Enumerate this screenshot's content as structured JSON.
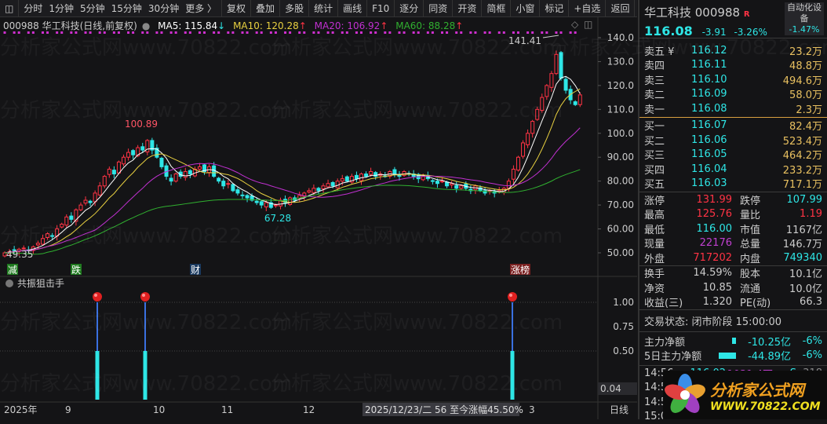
{
  "toolbar": {
    "periods": [
      "分时",
      "1分钟",
      "5分钟",
      "15分钟",
      "30分钟",
      "更多 〉"
    ],
    "buttons": [
      "复权",
      "叠加",
      "多股",
      "统计",
      "画线",
      "F10",
      "逐分",
      "同资",
      "开资",
      "简框",
      "小窗",
      "标记",
      "+自选",
      "返回"
    ]
  },
  "info": {
    "title": "000988 华工科技(日线,前复权)",
    "ma5": "MA5: 115.84",
    "ma10": "MA10: 120.28",
    "ma20": "MA20: 106.92",
    "ma60": "MA60: 88.28",
    "ma5_arrow": "↓",
    "ma10_arrow": "↑",
    "ma20_arrow": "↑",
    "ma60_arrow": "↑"
  },
  "colors": {
    "up": "#ff3344",
    "down": "#2ee6e6",
    "ma5": "#ffffff",
    "ma10": "#e8d040",
    "ma20": "#c030d0",
    "ma60": "#30b030"
  },
  "chart_data": {
    "type": "candlestick",
    "closes": [
      50,
      50.5,
      51,
      51.5,
      52,
      51,
      52.5,
      54,
      56,
      58,
      57,
      60,
      62,
      65,
      64,
      68,
      70,
      72,
      71,
      75,
      78,
      82,
      85,
      83,
      88,
      90,
      92,
      91,
      94,
      93,
      97,
      93,
      90,
      86,
      82,
      80,
      83,
      82,
      84,
      83,
      85,
      86,
      84,
      86,
      82,
      80,
      78,
      79,
      76,
      75,
      74,
      73,
      72,
      71,
      70,
      71,
      69,
      70,
      72,
      71,
      73,
      72,
      74,
      75,
      76,
      77,
      76,
      78,
      79,
      78,
      80,
      81,
      80,
      82,
      81,
      83,
      82,
      84,
      82,
      83,
      82,
      84,
      83,
      82,
      84,
      83,
      82,
      81,
      82,
      81,
      80,
      79,
      80,
      78,
      79,
      77,
      78,
      77,
      76,
      78,
      76,
      75,
      76,
      75,
      76,
      77,
      80,
      85,
      90,
      96,
      100,
      105,
      110,
      115,
      120,
      125,
      133,
      123,
      118,
      114,
      112,
      116.08
    ],
    "ylim": [
      45,
      145
    ],
    "yticks": [
      "140.0",
      "130.0",
      "120.0",
      "110.0",
      "100.0",
      "90.00",
      "80.00",
      "70.00",
      "60.00",
      "50.00"
    ],
    "ytick_values": [
      140,
      130,
      120,
      110,
      100,
      90,
      80,
      70,
      60,
      50
    ],
    "annotations": {
      "high": "141.41",
      "mid_high": "100.89",
      "low": "67.28",
      "start": "49.35"
    },
    "events": [
      "减",
      "跌",
      "财",
      "涨榜"
    ],
    "xticks": [
      "2025年",
      "9",
      "10",
      "11",
      "12",
      "3"
    ],
    "xtick_status": "2025/12/23/二 56 至今涨幅45.50%",
    "period": "日线"
  },
  "indicator": {
    "name": "共振狙击手",
    "yticks": [
      "1.00",
      "0.75",
      "0.50"
    ],
    "current": "0.04",
    "signals": [
      1,
      1,
      1
    ]
  },
  "quote": {
    "name": "华工科技 000988",
    "r": "R",
    "price": "116.08",
    "chg": "-3.91",
    "pct": "-3.26%",
    "sector": "自动化设备",
    "sector_pct": "-1.47%",
    "asks": [
      [
        "卖五 ¥",
        "116.12",
        "23.2万"
      ],
      [
        "卖四",
        "116.11",
        "48.8万"
      ],
      [
        "卖三",
        "116.10",
        "494.6万"
      ],
      [
        "卖二",
        "116.09",
        "58.0万"
      ],
      [
        "卖一",
        "116.08",
        "2.3万"
      ]
    ],
    "bids": [
      [
        "买一",
        "116.07",
        "82.4万"
      ],
      [
        "买二",
        "116.06",
        "523.4万"
      ],
      [
        "买三",
        "116.05",
        "464.2万"
      ],
      [
        "买四",
        "116.04",
        "233.2万"
      ],
      [
        "买五",
        "116.03",
        "717.1万"
      ]
    ],
    "stats": [
      [
        "涨停",
        "131.99",
        "跌停",
        "107.99"
      ],
      [
        "最高",
        "125.76",
        "量比",
        "1.19"
      ],
      [
        "最低",
        "116.00",
        "市值",
        "1167亿"
      ],
      [
        "现量",
        "22176",
        "总量",
        "146.7万"
      ],
      [
        "外盘",
        "717202",
        "内盘",
        "749340"
      ]
    ],
    "stats2": [
      [
        "换手",
        "14.59%",
        "股本",
        "10.1亿"
      ],
      [
        "净资",
        "10.85",
        "流通",
        "10.0亿"
      ],
      [
        "收益(三)",
        "1.320",
        "PE(动)",
        "66.3"
      ]
    ],
    "status": "交易状态: 闭市阶段 15:00:00",
    "flow": [
      [
        "主力净额",
        "-10.25亿",
        "-6%"
      ],
      [
        "5日主力净额",
        "-44.89亿",
        "-6%"
      ]
    ],
    "ticks": [
      [
        "14:56",
        "116.02",
        "1031.4万",
        "S",
        "318"
      ],
      [
        "14:5",
        ""
      ],
      [
        "14:5",
        ""
      ],
      [
        "15:0",
        ""
      ]
    ]
  },
  "watermark": "分析家公式网www.70822.com",
  "logo": {
    "title": "分析家公式网",
    "url": "WWW.70822.COM"
  }
}
